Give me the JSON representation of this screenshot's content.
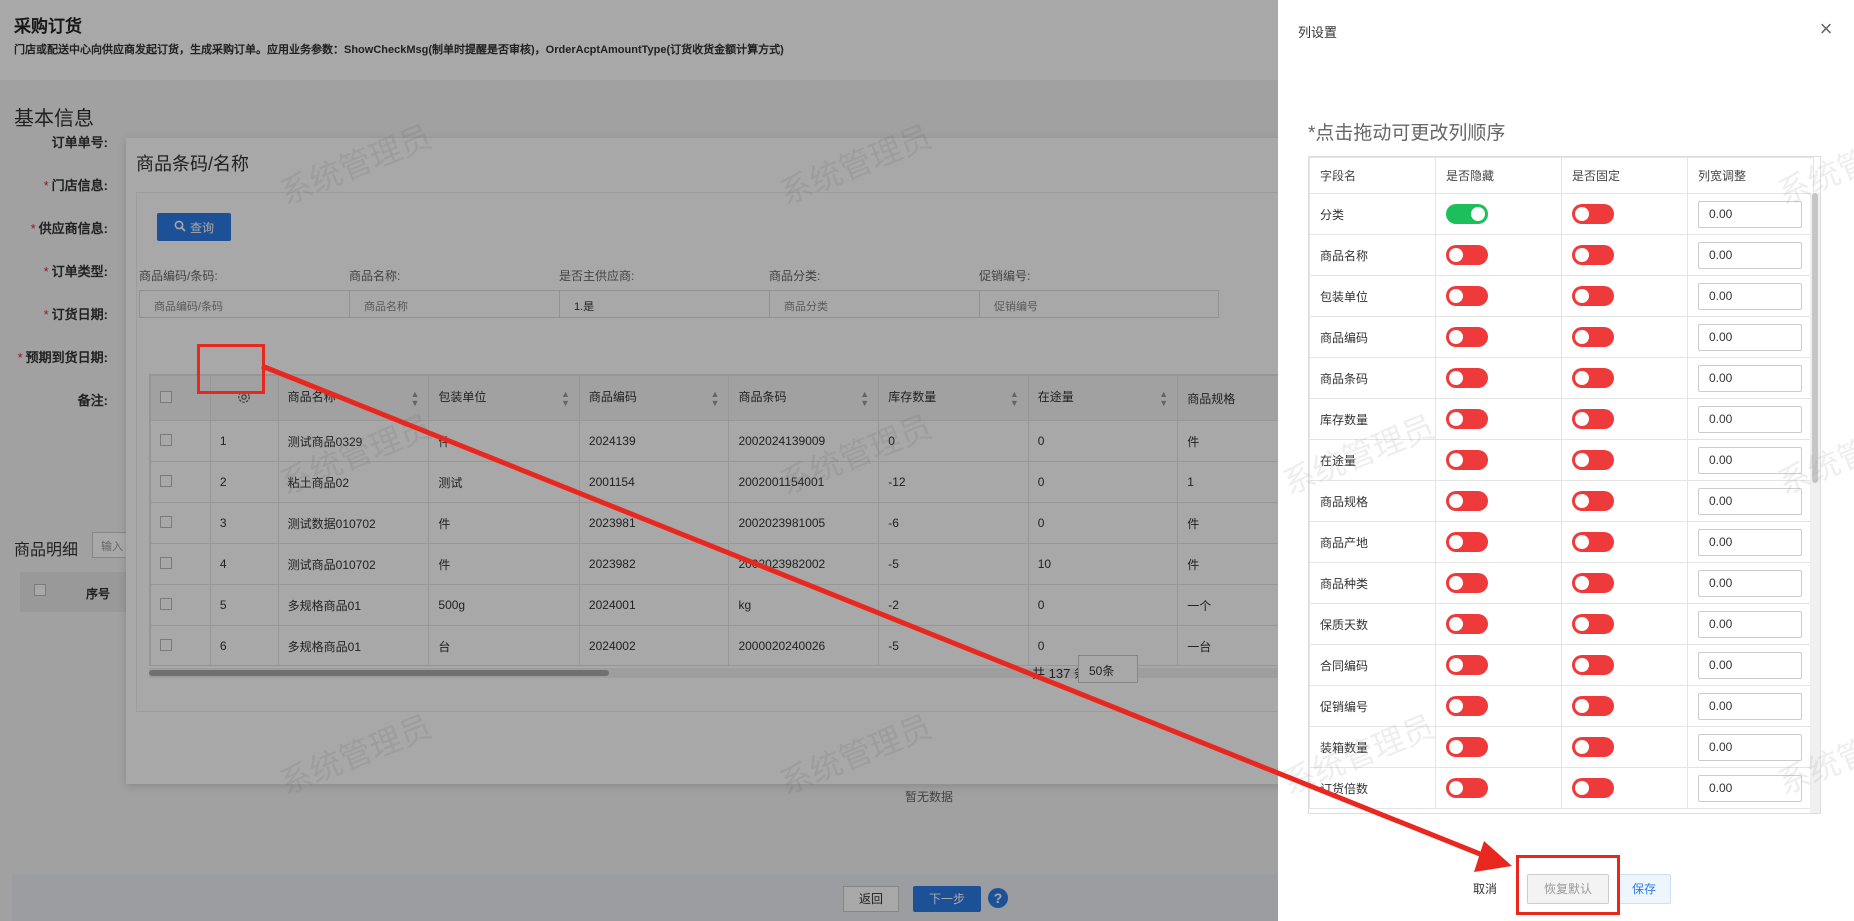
{
  "page": {
    "title": "采购订货",
    "description": "门店或配送中心向供应商发起订货，生成采购订单。应用业务参数：ShowCheckMsg(制单时提醒是否审核)，OrderAcptAmountType(订货收货金额计算方式)",
    "section_basic": "基本信息",
    "form_labels": {
      "order_no": "订单单号:",
      "store": "门店信息:",
      "supplier": "供应商信息:",
      "order_type": "订单类型:",
      "order_date": "订货日期:",
      "arrival_date": "预期到货日期:",
      "remark": "备注:"
    },
    "section_detail": "商品明细",
    "detail_input_placeholder": "输入",
    "detail_col_seq": "序号",
    "no_data": "暂无数据",
    "back_label": "返回",
    "next_label": "下一步",
    "help_label": "?"
  },
  "picker": {
    "title": "商品条码/名称",
    "query_label": "查询",
    "filters": [
      {
        "label": "商品编码/条码:",
        "placeholder": "商品编码/条码"
      },
      {
        "label": "商品名称:",
        "placeholder": "商品名称"
      },
      {
        "label": "是否主供应商:",
        "value": "1.是"
      },
      {
        "label": "商品分类:",
        "placeholder": "商品分类"
      },
      {
        "label": "促销编号:",
        "placeholder": "促销编号"
      }
    ],
    "columns": [
      "商品名称",
      "包装单位",
      "商品编码",
      "商品条码",
      "库存数量",
      "在途量",
      "商品规格"
    ],
    "rows": [
      {
        "seq": "1",
        "name": "测试商品0329",
        "unit": "件",
        "code": "2024139",
        "barcode": "2002024139009",
        "stock": "0",
        "transit": "0",
        "spec": "件"
      },
      {
        "seq": "2",
        "name": "粘土商品02",
        "unit": "测试",
        "code": "2001154",
        "barcode": "2002001154001",
        "stock": "-12",
        "transit": "0",
        "spec": "1"
      },
      {
        "seq": "3",
        "name": "测试数据010702",
        "unit": "件",
        "code": "2023981",
        "barcode": "2002023981005",
        "stock": "-6",
        "transit": "0",
        "spec": "件"
      },
      {
        "seq": "4",
        "name": "测试商品010702",
        "unit": "件",
        "code": "2023982",
        "barcode": "2002023982002",
        "stock": "-5",
        "transit": "10",
        "spec": "件"
      },
      {
        "seq": "5",
        "name": "多规格商品01",
        "unit": "500g",
        "code": "2024001",
        "barcode": "kg",
        "stock": "-2",
        "transit": "0",
        "spec": "一个"
      },
      {
        "seq": "6",
        "name": "多规格商品01",
        "unit": "台",
        "code": "2024002",
        "barcode": "2000020240026",
        "stock": "-5",
        "transit": "0",
        "spec": "一台"
      }
    ],
    "total": "共 137 条",
    "page_size": "50条"
  },
  "drawer": {
    "title": "列设置",
    "close": "×",
    "hint": "*点击拖动可更改列顺序",
    "headers": [
      "字段名",
      "是否隐藏",
      "是否固定",
      "列宽调整"
    ],
    "rows": [
      {
        "field": "分类",
        "hidden": true,
        "fixed": false,
        "width": "0.00"
      },
      {
        "field": "商品名称",
        "hidden": false,
        "fixed": false,
        "width": "0.00"
      },
      {
        "field": "包装单位",
        "hidden": false,
        "fixed": false,
        "width": "0.00"
      },
      {
        "field": "商品编码",
        "hidden": false,
        "fixed": false,
        "width": "0.00"
      },
      {
        "field": "商品条码",
        "hidden": false,
        "fixed": false,
        "width": "0.00"
      },
      {
        "field": "库存数量",
        "hidden": false,
        "fixed": false,
        "width": "0.00"
      },
      {
        "field": "在途量",
        "hidden": false,
        "fixed": false,
        "width": "0.00"
      },
      {
        "field": "商品规格",
        "hidden": false,
        "fixed": false,
        "width": "0.00"
      },
      {
        "field": "商品产地",
        "hidden": false,
        "fixed": false,
        "width": "0.00"
      },
      {
        "field": "商品种类",
        "hidden": false,
        "fixed": false,
        "width": "0.00"
      },
      {
        "field": "保质天数",
        "hidden": false,
        "fixed": false,
        "width": "0.00"
      },
      {
        "field": "合同编码",
        "hidden": false,
        "fixed": false,
        "width": "0.00"
      },
      {
        "field": "促销编号",
        "hidden": false,
        "fixed": false,
        "width": "0.00"
      },
      {
        "field": "装箱数量",
        "hidden": false,
        "fixed": false,
        "width": "0.00"
      },
      {
        "field": "订货倍数",
        "hidden": false,
        "fixed": false,
        "width": "0.00"
      }
    ],
    "cancel_label": "取消",
    "reset_label": "恢复默认",
    "save_label": "保存"
  },
  "watermark": "系统管理员",
  "colors": {
    "primary": "#2d7be6",
    "toggle_on": "#1dbf5d",
    "toggle_off": "#ee3a3a",
    "annotation": "#e8281f"
  }
}
